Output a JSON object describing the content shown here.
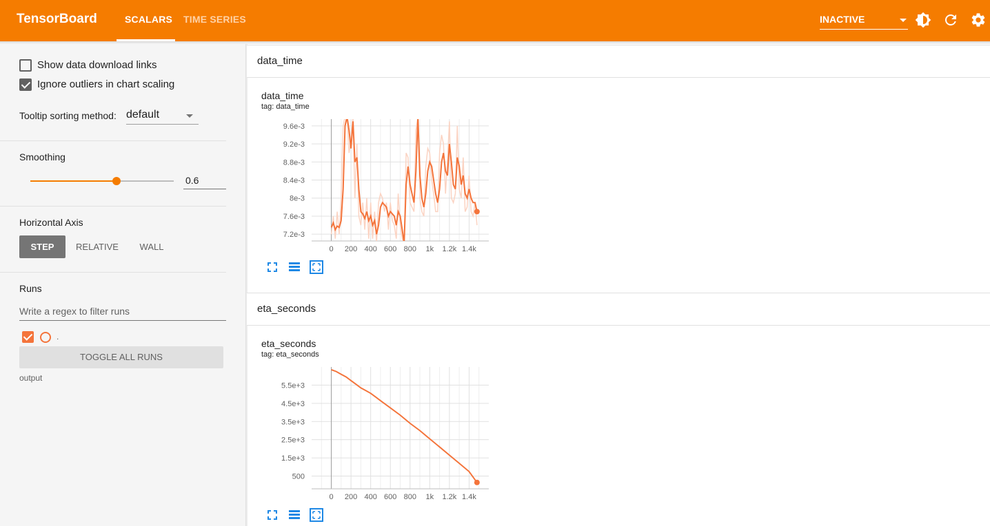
{
  "app": {
    "title": "TensorBoard",
    "tabs": [
      {
        "label": "SCALARS",
        "active": true
      },
      {
        "label": "TIME SERIES",
        "active": false
      }
    ],
    "status_select": "INACTIVE",
    "icons": [
      "theme-icon",
      "refresh-icon",
      "settings-icon"
    ],
    "accent_color": "#f57c00",
    "run_color": "#f4743b"
  },
  "sidebar": {
    "show_download_links": {
      "label": "Show data download links",
      "checked": false
    },
    "ignore_outliers": {
      "label": "Ignore outliers in chart scaling",
      "checked": true
    },
    "tooltip_sorting": {
      "label": "Tooltip sorting method:",
      "value": "default"
    },
    "smoothing": {
      "label": "Smoothing",
      "value": "0.6",
      "fraction": 0.6
    },
    "horizontal_axis": {
      "label": "Horizontal Axis",
      "options": [
        "STEP",
        "RELATIVE",
        "WALL"
      ],
      "selected": "STEP"
    },
    "runs": {
      "label": "Runs",
      "filter_placeholder": "Write a regex to filter runs",
      "items": [
        {
          "name": ".",
          "checked": true
        }
      ],
      "toggle_label": "TOGGLE ALL RUNS",
      "output_label": "output"
    }
  },
  "groups": [
    {
      "header": "data_time",
      "card": {
        "title": "data_time",
        "tag": "tag: data_time"
      }
    },
    {
      "header": "eta_seconds",
      "card": {
        "title": "eta_seconds",
        "tag": "tag: eta_seconds"
      }
    }
  ],
  "chart_data": [
    {
      "type": "line",
      "title": "data_time",
      "subtitle": "tag: data_time",
      "xlim": [
        -200,
        1600
      ],
      "ylim": [
        0.00705,
        0.00975
      ],
      "x_ticks": [
        0,
        200,
        400,
        600,
        800,
        1000,
        1200,
        1400
      ],
      "x_tick_labels": [
        "0",
        "200",
        "400",
        "600",
        "800",
        "1k",
        "1.2k",
        "1.4k"
      ],
      "y_ticks": [
        0.0072,
        0.0076,
        0.008,
        0.0084,
        0.0088,
        0.0092,
        0.0096
      ],
      "y_tick_labels": [
        "7.2e-3",
        "7.6e-3",
        "8e-3",
        "8.4e-3",
        "8.8e-3",
        "9.2e-3",
        "9.6e-3"
      ],
      "series": [
        {
          "smoothed": true,
          "x": [
            0,
            20,
            40,
            60,
            80,
            100,
            120,
            140,
            160,
            180,
            200,
            220,
            240,
            260,
            280,
            300,
            320,
            340,
            360,
            380,
            400,
            420,
            440,
            460,
            480,
            500,
            520,
            540,
            560,
            580,
            600,
            620,
            640,
            660,
            680,
            700,
            720,
            740,
            760,
            780,
            800,
            820,
            840,
            860,
            880,
            900,
            920,
            940,
            960,
            980,
            1000,
            1020,
            1040,
            1060,
            1080,
            1100,
            1120,
            1140,
            1160,
            1180,
            1200,
            1220,
            1240,
            1260,
            1280,
            1300,
            1320,
            1340,
            1360,
            1380,
            1400,
            1420,
            1440,
            1460,
            1480
          ],
          "values": [
            0.00735,
            0.00745,
            0.0073,
            0.00738,
            0.00735,
            0.0075,
            0.0082,
            0.0096,
            0.0098,
            0.0095,
            0.0091,
            0.0097,
            0.0088,
            0.0089,
            0.0082,
            0.0077,
            0.00765,
            0.00755,
            0.0077,
            0.0075,
            0.0076,
            0.0074,
            0.0075,
            0.0072,
            0.0074,
            0.0078,
            0.0079,
            0.00785,
            0.0078,
            0.0076,
            0.0077,
            0.00765,
            0.0076,
            0.0074,
            0.0077,
            0.0076,
            0.0073,
            0.007,
            0.0083,
            0.0087,
            0.0083,
            0.0081,
            0.0079,
            0.0086,
            0.0098,
            0.0085,
            0.008,
            0.0078,
            0.0081,
            0.0086,
            0.0088,
            0.0087,
            0.0084,
            0.0081,
            0.0079,
            0.0082,
            0.0088,
            0.009,
            0.0086,
            0.0085,
            0.0092,
            0.0088,
            0.0083,
            0.0082,
            0.0089,
            0.0087,
            0.0083,
            0.0085,
            0.0081,
            0.008,
            0.0082,
            0.008,
            0.0079,
            0.0079,
            0.0077
          ]
        },
        {
          "smoothed": false,
          "x": [
            0,
            20,
            40,
            60,
            80,
            100,
            120,
            140,
            160,
            180,
            200,
            220,
            240,
            260,
            280,
            300,
            320,
            340,
            360,
            380,
            400,
            420,
            440,
            460,
            480,
            500,
            520,
            540,
            560,
            580,
            600,
            620,
            640,
            660,
            680,
            700,
            720,
            740,
            760,
            780,
            800,
            820,
            840,
            860,
            880,
            900,
            920,
            940,
            960,
            980,
            1000,
            1020,
            1040,
            1060,
            1080,
            1100,
            1120,
            1140,
            1160,
            1180,
            1200,
            1220,
            1240,
            1260,
            1280,
            1300,
            1320,
            1340,
            1360,
            1380,
            1400,
            1420,
            1440,
            1460,
            1480
          ],
          "values": [
            0.0072,
            0.0076,
            0.0071,
            0.0077,
            0.0072,
            0.008,
            0.0096,
            0.0098,
            0.0098,
            0.009,
            0.0093,
            0.0098,
            0.008,
            0.0092,
            0.0076,
            0.0074,
            0.0079,
            0.0073,
            0.008,
            0.0071,
            0.0079,
            0.0071,
            0.0077,
            0.007,
            0.0079,
            0.0081,
            0.008,
            0.0077,
            0.0079,
            0.0073,
            0.0079,
            0.0075,
            0.0074,
            0.0071,
            0.0081,
            0.0074,
            0.0071,
            0.007,
            0.009,
            0.0089,
            0.0079,
            0.0078,
            0.0077,
            0.0095,
            0.0098,
            0.008,
            0.0077,
            0.0076,
            0.0087,
            0.0091,
            0.009,
            0.0084,
            0.0081,
            0.0077,
            0.0077,
            0.009,
            0.0094,
            0.0092,
            0.0081,
            0.0088,
            0.0097,
            0.008,
            0.0079,
            0.0081,
            0.0096,
            0.0082,
            0.008,
            0.0089,
            0.0077,
            0.0078,
            0.0085,
            0.0077,
            0.0076,
            0.0079,
            0.0074
          ]
        }
      ]
    },
    {
      "type": "line",
      "title": "eta_seconds",
      "subtitle": "tag: eta_seconds",
      "xlim": [
        -200,
        1600
      ],
      "ylim": [
        -200,
        6500
      ],
      "x_ticks": [
        0,
        200,
        400,
        600,
        800,
        1000,
        1200,
        1400
      ],
      "x_tick_labels": [
        "0",
        "200",
        "400",
        "600",
        "800",
        "1k",
        "1.2k",
        "1.4k"
      ],
      "y_ticks": [
        500,
        1500,
        2500,
        3500,
        4500,
        5500
      ],
      "y_tick_labels": [
        "500",
        "1.5e+3",
        "2.5e+3",
        "3.5e+3",
        "4.5e+3",
        "5.5e+3"
      ],
      "series": [
        {
          "smoothed": true,
          "x": [
            0,
            50,
            100,
            150,
            200,
            250,
            300,
            350,
            400,
            450,
            500,
            600,
            700,
            800,
            900,
            1000,
            1100,
            1200,
            1300,
            1400,
            1480
          ],
          "values": [
            6350,
            6250,
            6100,
            5950,
            5750,
            5550,
            5350,
            5200,
            5050,
            4850,
            4650,
            4250,
            3850,
            3400,
            3000,
            2550,
            2100,
            1650,
            1200,
            750,
            150
          ]
        }
      ]
    }
  ]
}
